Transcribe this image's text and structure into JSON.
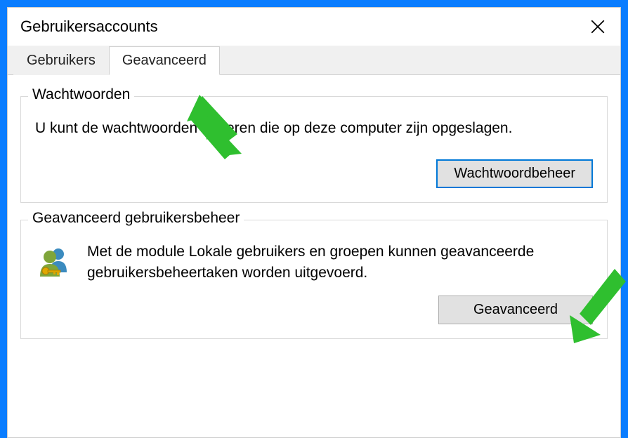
{
  "titlebar": {
    "title": "Gebruikersaccounts"
  },
  "tabs": [
    {
      "label": "Gebruikers",
      "active": false
    },
    {
      "label": "Geavanceerd",
      "active": true
    }
  ],
  "passwords_group": {
    "legend": "Wachtwoorden",
    "text": "U kunt de wachtwoorden beheren die op deze computer zijn opgeslagen.",
    "button": "Wachtwoordbeheer"
  },
  "advanced_group": {
    "legend": "Geavanceerd gebruikersbeheer",
    "text": "Met de module Lokale gebruikers en groepen kunnen geavanceerde gebruikersbeheertaken worden uitgevoerd.",
    "button": "Geavanceerd"
  }
}
